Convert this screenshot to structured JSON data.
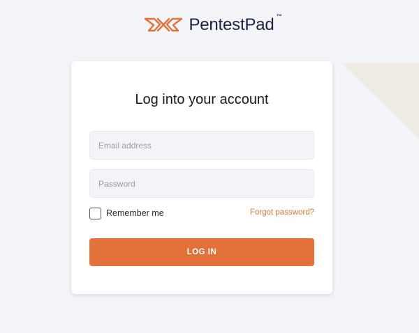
{
  "brand": {
    "name": "PentestPad",
    "trademark": "™",
    "logo_icon": "pentestpad-logo-icon",
    "accent_color": "#e2713a"
  },
  "login": {
    "title": "Log into your account",
    "email_placeholder": "Email address",
    "password_placeholder": "Password",
    "remember_label": "Remember me",
    "remember_checked": false,
    "forgot_label": "Forgot password?",
    "submit_label": "LOG IN"
  },
  "colors": {
    "background": "#f3f4f7",
    "accent": "#e2713a",
    "decor_shape": "#f1ebe5"
  }
}
